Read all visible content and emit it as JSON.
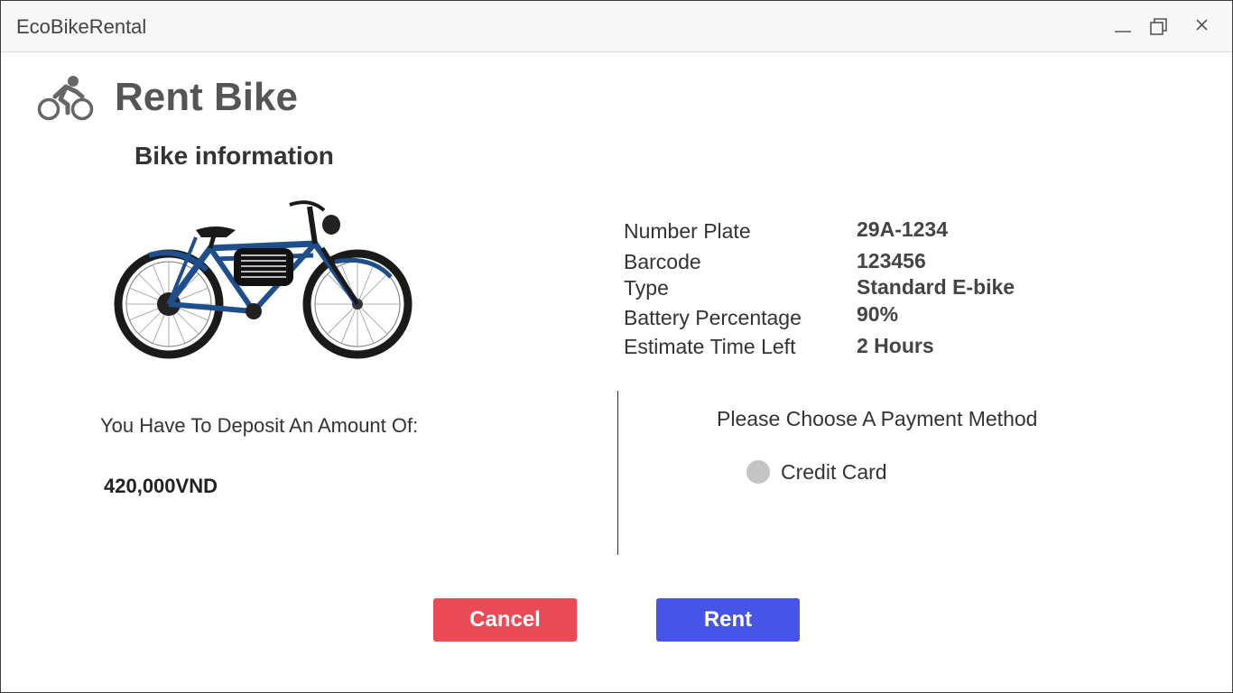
{
  "window": {
    "app_title": "EcoBikeRental",
    "controls": [
      "minimize-icon",
      "maximize-icon",
      "close-icon"
    ]
  },
  "header": {
    "icon": "cyclist-icon",
    "title": "Rent Bike"
  },
  "bike_info": {
    "section_title": "Bike information",
    "image": "electric-bike-image",
    "fields": [
      {
        "label": "Number Plate",
        "value": "29A-1234"
      },
      {
        "label": "Barcode",
        "value": "123456"
      },
      {
        "label": "Type",
        "value": "Standard E-bike"
      },
      {
        "label": "Battery Percentage",
        "value": "90%"
      },
      {
        "label": "Estimate Time Left",
        "value": "2 Hours"
      }
    ]
  },
  "deposit": {
    "label": "You Have To Deposit An Amount Of:",
    "amount": "420,000VND"
  },
  "payment": {
    "title": "Please Choose A Payment Method",
    "options": [
      {
        "label": "Credit Card",
        "selected": false
      }
    ]
  },
  "actions": {
    "cancel_label": "Cancel",
    "rent_label": "Rent"
  },
  "colors": {
    "cancel": "#e84b55",
    "rent": "#4655e8",
    "radio": "#c4c4c4"
  }
}
